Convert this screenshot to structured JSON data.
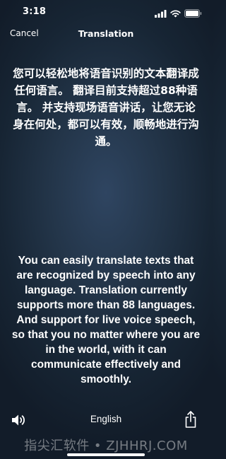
{
  "status_bar": {
    "time": "3:18",
    "icons": [
      "cellular-signal-icon",
      "wifi-icon",
      "battery-icon"
    ]
  },
  "nav": {
    "cancel_label": "Cancel",
    "title": "Translation"
  },
  "source_text": "您可以轻松地将语音识别的文本翻译成任何语言。 翻译目前支持超过88种语言。 并支持现场语音讲话，让您无论身在何处，都可以有效，顺畅地进行沟通。",
  "translated_text": "You can easily translate texts that are recognized by speech into any language. Translation currently supports more than 88 languages. And support for live voice speech, so that you no matter where you are in the world, with it can communicate effectively and smoothly.",
  "bottom_bar": {
    "speaker_icon": "speaker-icon",
    "target_language": "English",
    "share_icon": "share-icon"
  },
  "watermark": "指尖汇软件 • ZJHHRJ.COM",
  "colors": {
    "background_center": "#2f4561",
    "background_edge": "#121c29",
    "text": "#ffffff"
  }
}
